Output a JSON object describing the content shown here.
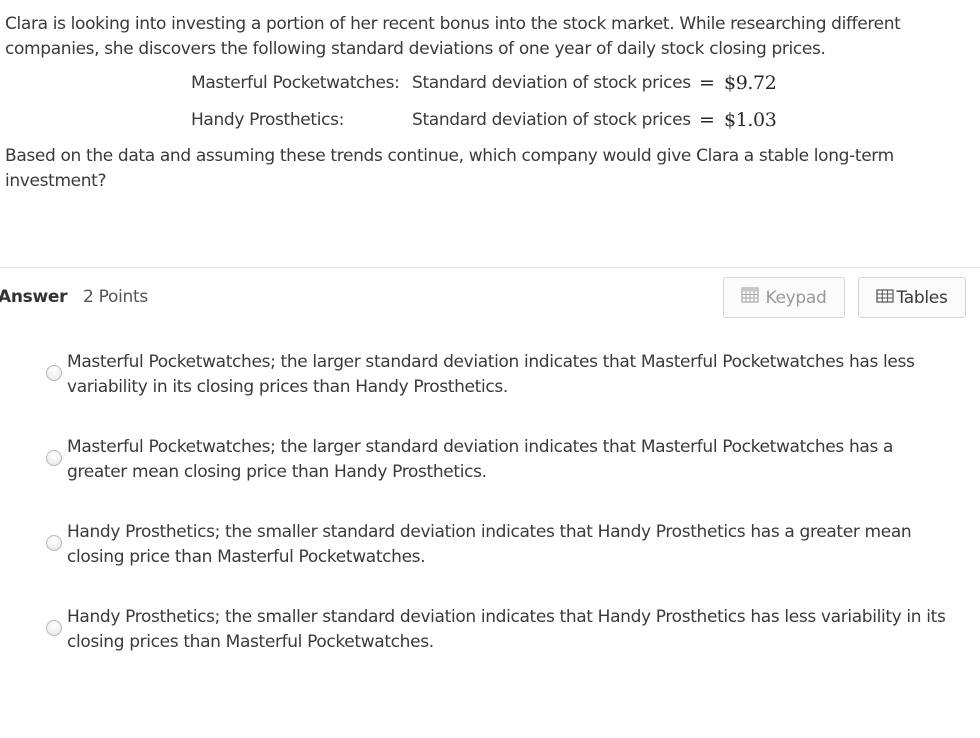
{
  "question": {
    "intro": "Clara is looking into investing a portion of her recent bonus into the stock market. While researching different companies, she discovers the following standard deviations of one year of daily stock closing prices.",
    "rows": [
      {
        "company": "Masterful Pocketwatches:",
        "description": "Standard deviation of stock prices",
        "equals": "=",
        "value": "$9.72"
      },
      {
        "company": "Handy Prosthetics:",
        "description": "Standard deviation of stock prices",
        "equals": "=",
        "value": "$1.03"
      }
    ],
    "prompt": "Based on the data and assuming these trends continue, which company would give Clara a stable long-term investment?"
  },
  "answer": {
    "label": "Answer",
    "points": "2 Points",
    "keypad_label": "Keypad",
    "tables_label": "Tables",
    "icons": {
      "keypad": "keypad-icon",
      "tables": "table-icon"
    }
  },
  "options": [
    "Masterful Pocketwatches; the larger standard deviation indicates that Masterful Pocketwatches has less variability in its closing prices than Handy Prosthetics.",
    "Masterful Pocketwatches; the larger standard deviation indicates that Masterful Pocketwatches has a greater mean closing price than Handy Prosthetics.",
    "Handy Prosthetics; the smaller standard deviation indicates that Handy Prosthetics has a greater mean closing price than Masterful Pocketwatches.",
    "Handy Prosthetics; the smaller standard deviation indicates that Handy Prosthetics has less variability in its closing prices than Masterful Pocketwatches."
  ],
  "colors": {
    "text": "#3a3a3a",
    "divider": "#e3e3e3",
    "button_border": "#d6d6d6",
    "keypad_text": "#9a9a9a"
  }
}
